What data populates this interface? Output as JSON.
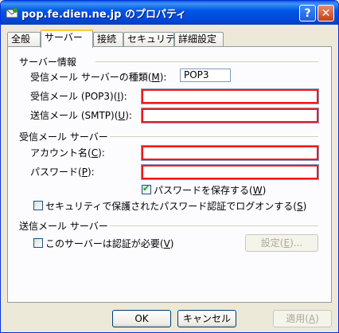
{
  "window": {
    "title": "pop.fe.dien.ne.jp のプロパティ"
  },
  "titlebar_buttons": {
    "help": "?",
    "close": "✕"
  },
  "tabs": [
    "全般",
    "サーバー",
    "接続",
    "セキュリティ",
    "詳細設定"
  ],
  "server_info": {
    "heading": "サーバー情報",
    "incoming_type_label": "受信メール サーバーの種類(",
    "incoming_type_key": "M",
    "incoming_type_value": "POP3",
    "incoming_pop3_label": "受信メール (POP3)(",
    "incoming_pop3_key": "I",
    "incoming_pop3_value": "",
    "outgoing_smtp_label": "送信メール (SMTP)(",
    "outgoing_smtp_key": "U",
    "outgoing_smtp_value": ""
  },
  "incoming_server": {
    "heading": "受信メール サーバー",
    "account_label": "アカウント名(",
    "account_key": "C",
    "account_value": "",
    "password_label": "パスワード(",
    "password_key": "P",
    "password_value": "",
    "remember_password_label": "パスワードを保存する(",
    "remember_password_key": "W",
    "remember_password_checked": true,
    "spa_label": "セキュリティで保護されたパスワード認証でログオンする(",
    "spa_key": "S",
    "spa_checked": false
  },
  "outgoing_server": {
    "heading": "送信メール サーバー",
    "auth_required_label": "このサーバーは認証が必要(",
    "auth_required_key": "V",
    "auth_required_checked": false,
    "settings_button_label": "設定(",
    "settings_button_key": "E",
    "settings_button_suffix": ")..."
  },
  "buttons": {
    "ok": "OK",
    "cancel": "キャンセル",
    "apply_label": "適用(",
    "apply_key": "A"
  },
  "close_paren": "):",
  "close_paren_plain": ")"
}
